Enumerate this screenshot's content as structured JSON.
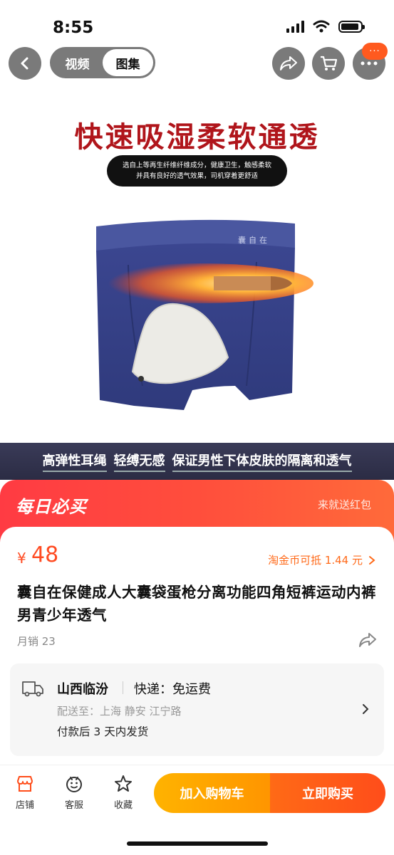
{
  "status": {
    "time": "8:55"
  },
  "nav": {
    "tabs": [
      {
        "label": "视频"
      },
      {
        "label": "图集"
      }
    ],
    "more_badge": "···"
  },
  "hero": {
    "headline": "快速吸湿柔软通透",
    "pill_line1": "选自上等再生纤维纤维成分，健康卫生，触感柔软",
    "pill_line2": "并具有良好的透气效果，司机穿着更舒适",
    "brand_on_waistband": "囊自在",
    "features": [
      "高弹性耳绳",
      "轻缚无感",
      "保证男性下体皮肤的隔离和透气"
    ]
  },
  "deal": {
    "title": "每日必买",
    "right_text": "来就送红包"
  },
  "product": {
    "currency": "¥",
    "price": "48",
    "coin_text": "淘金币可抵 1.44 元",
    "title": "囊自在保健成人大囊袋蛋枪分离功能四角短裤运动内裤男青少年透气",
    "sales": "月销 23"
  },
  "shipping": {
    "origin": "山西临汾",
    "express": "快递：免运费",
    "deliver_to": "配送至：上海 静安 江宁路",
    "dispatch": "付款后 3 天内发货"
  },
  "bottom": {
    "tabs": [
      {
        "label": "店铺"
      },
      {
        "label": "客服"
      },
      {
        "label": "收藏"
      }
    ],
    "add_cart": "加入购物车",
    "buy_now": "立即购买"
  },
  "colors": {
    "accent": "#ff4b22",
    "deal_red": "#ff3b43",
    "cart_yellow": "#ffb300",
    "buy_orange": "#ff5a1a"
  }
}
